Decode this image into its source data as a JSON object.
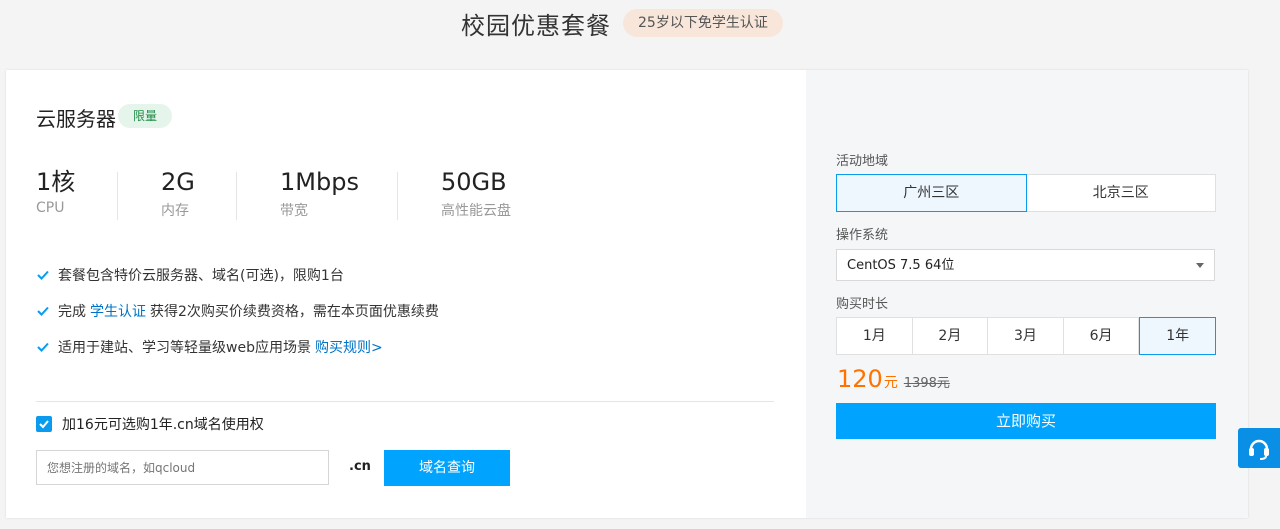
{
  "header": {
    "title": "校园优惠套餐",
    "badge": "25岁以下免学生认证"
  },
  "product": {
    "title": "云服务器",
    "badge": "限量",
    "specs": [
      {
        "value": "1核",
        "label": "CPU"
      },
      {
        "value": "2G",
        "label": "内存"
      },
      {
        "value": "1Mbps",
        "label": "带宽"
      },
      {
        "value": "50GB",
        "label": "高性能云盘"
      }
    ],
    "features": {
      "f1": "套餐包含特价云服务器、域名(可选)，限购1台",
      "f2_pre": "完成",
      "f2_link": "学生认证",
      "f2_post": "获得2次购买价续费资格，需在本页面优惠续费",
      "f3_pre": "适用于建站、学习等轻量级web应用场景",
      "f3_link": "购买规则>"
    }
  },
  "domain": {
    "checkbox_label": "加16元可选购1年.cn域名使用权",
    "checked": true,
    "input_placeholder": "您想注册的域名，如qcloud",
    "suffix": ".cn",
    "search_button": "域名查询"
  },
  "order": {
    "region_label": "活动地域",
    "regions": [
      "广州三区",
      "北京三区"
    ],
    "selected_region": "广州三区",
    "os_label": "操作系统",
    "os_value": "CentOS 7.5 64位",
    "duration_label": "购买时长",
    "durations": [
      "1月",
      "2月",
      "3月",
      "6月",
      "1年"
    ],
    "selected_duration": "1年",
    "price": "120",
    "price_unit": "元",
    "original_price": "1398元",
    "buy_button": "立即购买"
  },
  "colors": {
    "accent": "#00a4ff",
    "price": "#ff7200",
    "badge_green": "#1c8c43"
  },
  "icons": {
    "check": "check-icon",
    "help": "headset-icon"
  }
}
